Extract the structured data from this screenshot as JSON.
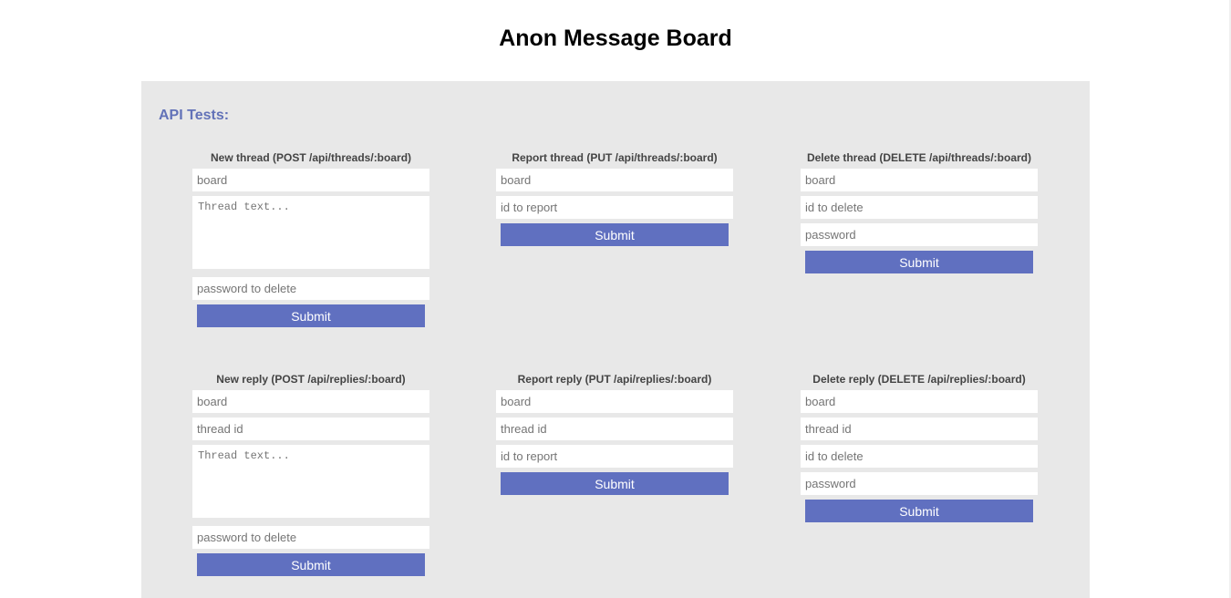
{
  "page": {
    "title": "Anon Message Board"
  },
  "panel": {
    "title": "API Tests:"
  },
  "new_thread": {
    "title": "New thread (POST /api/threads/:board)",
    "board_placeholder": "board",
    "text_placeholder": "Thread text...",
    "password_placeholder": "password to delete",
    "submit_label": "Submit"
  },
  "report_thread": {
    "title": "Report thread (PUT /api/threads/:board)",
    "board_placeholder": "board",
    "id_placeholder": "id to report",
    "submit_label": "Submit"
  },
  "delete_thread": {
    "title": "Delete thread (DELETE /api/threads/:board)",
    "board_placeholder": "board",
    "id_placeholder": "id to delete",
    "password_placeholder": "password",
    "submit_label": "Submit"
  },
  "new_reply": {
    "title": "New reply (POST /api/replies/:board)",
    "board_placeholder": "board",
    "thread_id_placeholder": "thread id",
    "text_placeholder": "Thread text...",
    "password_placeholder": "password to delete",
    "submit_label": "Submit"
  },
  "report_reply": {
    "title": "Report reply (PUT /api/replies/:board)",
    "board_placeholder": "board",
    "thread_id_placeholder": "thread id",
    "id_placeholder": "id to report",
    "submit_label": "Submit"
  },
  "delete_reply": {
    "title": "Delete reply (DELETE /api/replies/:board)",
    "board_placeholder": "board",
    "thread_id_placeholder": "thread id",
    "id_placeholder": "id to delete",
    "password_placeholder": "password",
    "submit_label": "Submit"
  },
  "colors": {
    "accent": "#6070c0",
    "panel_title": "#6272b8",
    "panel_background": "#e8e8e8"
  }
}
